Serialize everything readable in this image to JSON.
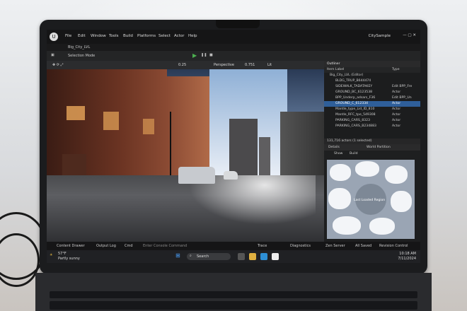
{
  "menubar": {
    "items": [
      "File",
      "Edit",
      "Window",
      "Tools",
      "Build",
      "Platforms",
      "Select",
      "Actor",
      "Help"
    ],
    "window_title": "CitySample"
  },
  "tabbar": {
    "level_name": "Big_City_LVL"
  },
  "toolbar": {
    "mode": "Selection Mode"
  },
  "viewport_bar": {
    "view": "Perspective",
    "lit": "Lit",
    "value1": "0.751",
    "value2": "0.25"
  },
  "outliner": {
    "title": "Outliner",
    "col_label": "Item Label",
    "col_type": "Type",
    "root": "Big_City_LVL (Editor)",
    "rows": [
      {
        "label": "BLDG_TRUP_B644474",
        "type": ""
      },
      {
        "label": "SIDEWALK_TADATAKEY",
        "type": "Edit BPP_Fre"
      },
      {
        "label": "GROUND_BC_6123538",
        "type": "Actor"
      },
      {
        "label": "BPP_Underp_adsars_F36",
        "type": "Edit BPP_Un"
      },
      {
        "label": "GROUND_C_612334",
        "type": "Actor"
      },
      {
        "label": "Mantle_type_Lid_ID_810",
        "type": "Actor"
      },
      {
        "label": "Mantle_RFC_tpe_549308",
        "type": "Actor"
      },
      {
        "label": "PARKING_CARS_8323",
        "type": "Actor"
      },
      {
        "label": "PARKING_CARS_B234883",
        "type": "Actor"
      }
    ],
    "footer": "131,716 actors (1 selected)"
  },
  "details": {
    "tab1": "Details",
    "tab2": "World Partition",
    "btn_show": "Show",
    "btn_build": "Build",
    "map_label": "Last Loaded Region"
  },
  "bottombar": {
    "content_drawer": "Content Drawer",
    "output_log": "Output Log",
    "cmd": "Cmd",
    "console_placeholder": "Enter Console Command",
    "trace": "Trace",
    "diagnostics": "Diagnostics",
    "zen": "Zen Server",
    "saved": "All Saved",
    "revision": "Revision Control"
  },
  "taskbar": {
    "weather_temp": "57°F",
    "weather_desc": "Partly sunny",
    "search": "Search",
    "time": "10:18 AM",
    "date": "7/11/2024"
  },
  "chart_data": []
}
